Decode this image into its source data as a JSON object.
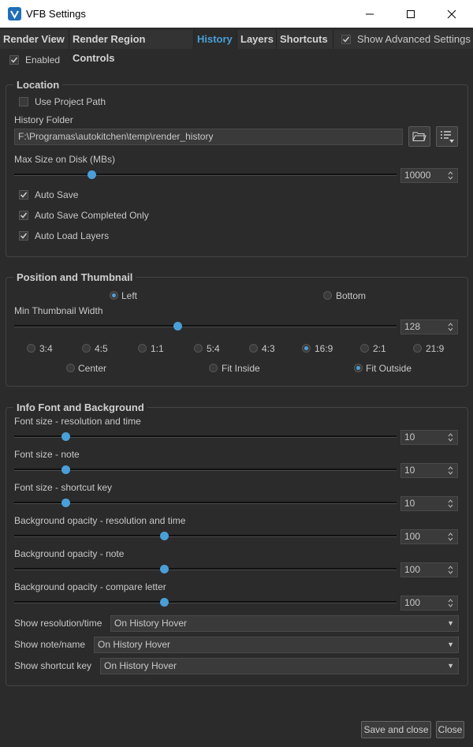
{
  "window": {
    "title": "VFB Settings"
  },
  "tabs": [
    {
      "label": "Render View"
    },
    {
      "label": "Render Region Controls"
    },
    {
      "label": "History"
    },
    {
      "label": "Layers"
    },
    {
      "label": "Shortcuts"
    }
  ],
  "show_advanced": {
    "label": "Show Advanced Settings",
    "checked": true
  },
  "enabled": {
    "label": "Enabled",
    "checked": true
  },
  "location": {
    "title": "Location",
    "use_project_path": {
      "label": "Use Project Path",
      "checked": false
    },
    "history_folder_label": "History Folder",
    "history_folder_value": "F:\\Programas\\autokitchen\\temp\\render_history",
    "max_size_label": "Max Size on Disk (MBs)",
    "max_size_value": "10000",
    "auto_save": {
      "label": "Auto Save",
      "checked": true
    },
    "auto_save_completed": {
      "label": "Auto Save Completed Only",
      "checked": true
    },
    "auto_load_layers": {
      "label": "Auto Load Layers",
      "checked": true
    }
  },
  "position": {
    "title": "Position and Thumbnail",
    "left_label": "Left",
    "bottom_label": "Bottom",
    "selected_position": "Left",
    "min_width_label": "Min Thumbnail Width",
    "min_width_value": "128",
    "aspects": [
      "3:4",
      "4:5",
      "1:1",
      "5:4",
      "4:3",
      "16:9",
      "2:1",
      "21:9"
    ],
    "selected_aspect": "16:9",
    "fits": [
      "Center",
      "Fit Inside",
      "Fit Outside"
    ],
    "selected_fit": "Fit Outside"
  },
  "info": {
    "title": "Info Font and Background",
    "sliders": [
      {
        "label": "Font size - resolution and time",
        "value": "10"
      },
      {
        "label": "Font size - note",
        "value": "10"
      },
      {
        "label": "Font size - shortcut key",
        "value": "10"
      },
      {
        "label": "Background opacity - resolution and time",
        "value": "100"
      },
      {
        "label": "Background opacity - note",
        "value": "100"
      },
      {
        "label": "Background opacity - compare letter",
        "value": "100"
      }
    ],
    "show_resolution_label": "Show resolution/time",
    "show_resolution_value": "On History Hover",
    "show_note_label": "Show note/name",
    "show_note_value": "On History Hover",
    "show_shortcut_label": "Show shortcut key",
    "show_shortcut_value": "On History Hover"
  },
  "buttons": {
    "save_close": "Save and close",
    "close": "Close"
  },
  "colors": {
    "accent": "#4a9fd8",
    "background": "#2b2b2b"
  }
}
